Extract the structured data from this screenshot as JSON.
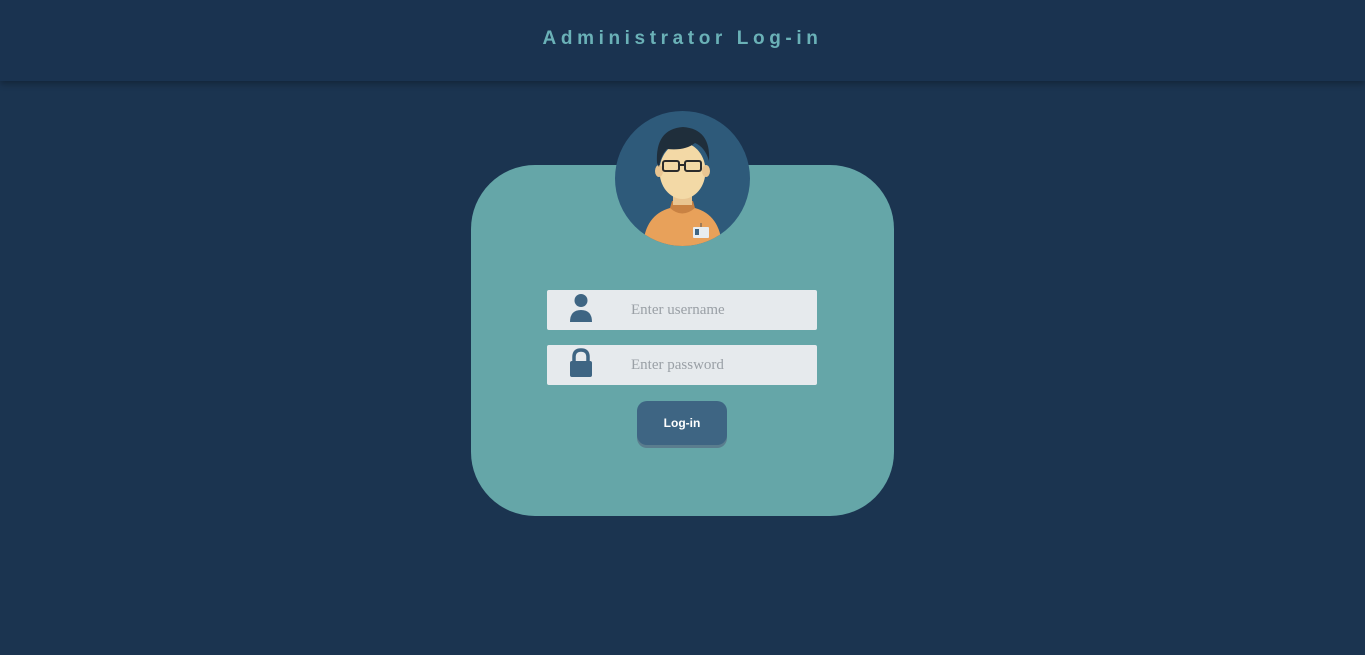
{
  "header": {
    "title": "Administrator Log-in"
  },
  "avatar": {
    "icon": "admin-avatar-icon"
  },
  "form": {
    "username": {
      "placeholder": "Enter username",
      "value": "",
      "icon": "user-icon"
    },
    "password": {
      "placeholder": "Enter password",
      "value": "",
      "icon": "lock-icon"
    },
    "submit_label": "Log-in"
  },
  "colors": {
    "background": "#1b3450",
    "header_title": "#6ab1b7",
    "card": "#65a6a8",
    "avatar_bg": "#2e5a7a",
    "field_bg": "#e6eaed",
    "icon": "#3e6583",
    "button": "#3e6583"
  }
}
